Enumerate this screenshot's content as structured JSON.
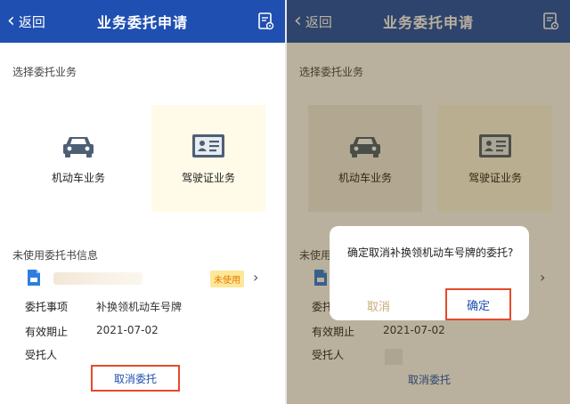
{
  "header": {
    "back_label": "返回",
    "title": "业务委托申请",
    "doc_icon": "document-gear-icon"
  },
  "select_section": {
    "label": "选择委托业务"
  },
  "cards": [
    {
      "label": "机动车业务",
      "icon": "car-icon"
    },
    {
      "label": "驾驶证业务",
      "icon": "id-card-icon"
    }
  ],
  "unused_section": {
    "label": "未使用委托书信息"
  },
  "entrust": {
    "badge": "未使用",
    "rows": [
      {
        "label": "委托事项",
        "value": "补换领机动车号牌"
      },
      {
        "label": "有效期止",
        "value": "2021-07-02"
      },
      {
        "label": "受托人",
        "value": ""
      }
    ],
    "cancel_label": "取消委托"
  },
  "dialog": {
    "message": "确定取消补换领机动车号牌的委托?",
    "cancel_label": "取消",
    "confirm_label": "确定"
  },
  "colors": {
    "header": "#1f4fb1",
    "highlight": "#e44a2a",
    "badge_bg": "#ffe79a",
    "badge_text": "#e07a00"
  }
}
